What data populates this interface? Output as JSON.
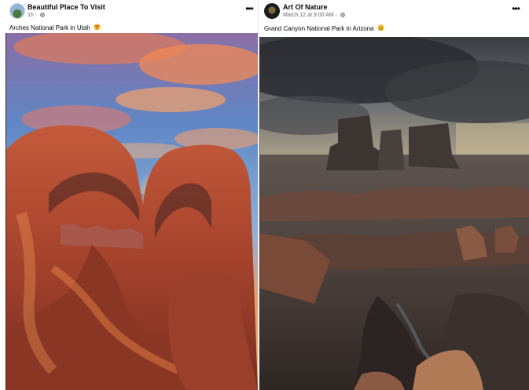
{
  "posts": [
    {
      "author": "Beautiful Place To Visit",
      "time": "1h",
      "caption": "Arches National Park in Utah",
      "emoji": "heart-eyes",
      "more_label": "•••"
    },
    {
      "author": "Art Of Nature",
      "time": "March 12 at 9:00 AM",
      "caption": "Grand Canyon National Park in Arizona",
      "emoji": "smiling-face",
      "more_label": "•••"
    }
  ],
  "separator": "·",
  "colors": {
    "feed_background": "#f0f2f5",
    "card_background": "#ffffff",
    "primary_text": "#050505",
    "secondary_text": "#65676b"
  }
}
